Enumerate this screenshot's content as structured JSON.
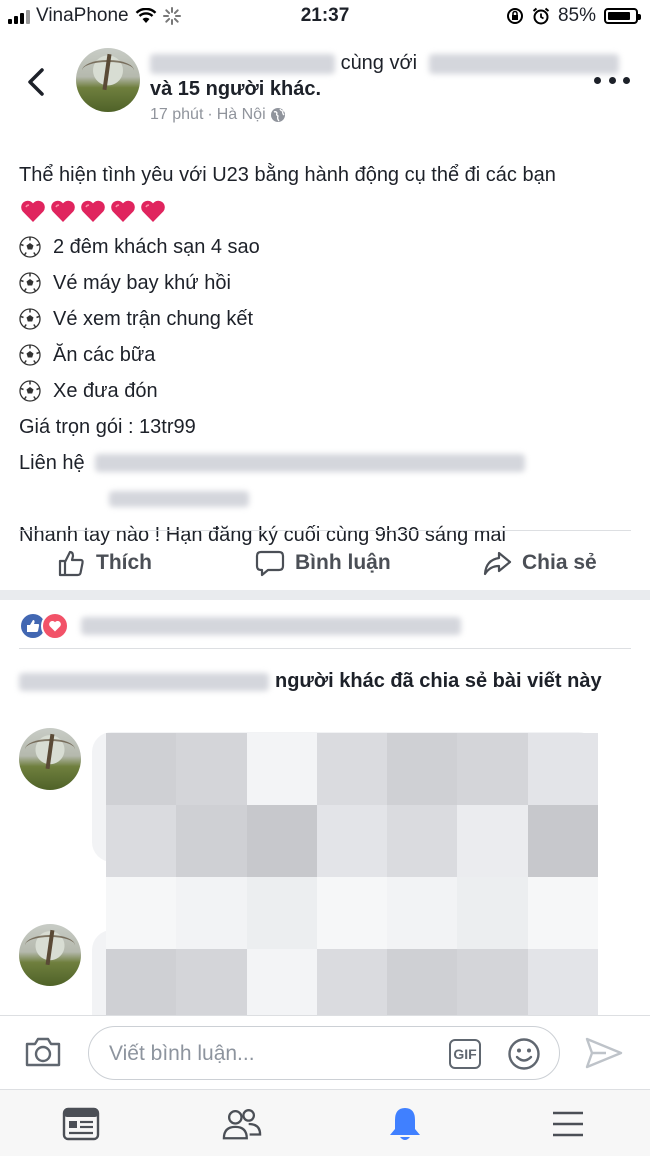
{
  "status_bar": {
    "carrier": "VinaPhone",
    "time": "21:37",
    "battery": "85%",
    "battery_level": 0.85
  },
  "post": {
    "with_text": "cùng với",
    "others_text": "và 15 người khác.",
    "time_ago": "17 phút",
    "location": "Hà Nội",
    "intro": "Thể hiện tình yêu với U23 bằng hành động cụ thể đi các bạn",
    "heart_count": 5,
    "items": [
      "2 đêm khách sạn 4 sao",
      "Vé máy bay khứ hồi",
      "Vé xem trận chung kết",
      "Ăn các bữa",
      "Xe đưa đón"
    ],
    "price": "Giá trọn gói : 13tr99",
    "contact_label": "Liên hệ",
    "deadline": "Nhanh tay nào ! Hạn đăng ký cuối cùng 9h30 sáng mai"
  },
  "actions": {
    "like": "Thích",
    "comment": "Bình luận",
    "share": "Chia sẻ"
  },
  "shares": {
    "suffix": "người khác đã chia sẻ bài viết này"
  },
  "composer": {
    "placeholder": "Viết bình luận...",
    "gif": "GIF"
  },
  "icons": {
    "back": "chevron-left-icon",
    "more": "more-icon",
    "globe": "globe-icon",
    "like": "thumbs-up-icon",
    "comment": "comment-bubble-icon",
    "share": "share-arrow-icon",
    "camera": "camera-icon",
    "emoji": "smiley-icon",
    "send": "send-icon",
    "news_feed": "news-feed-icon",
    "friends": "friends-icon",
    "notifications": "bell-icon",
    "menu": "menu-icon"
  },
  "colors": {
    "facebook_blue": "#4267b2",
    "love_red": "#f25268",
    "active_tab": "#4080ff"
  }
}
